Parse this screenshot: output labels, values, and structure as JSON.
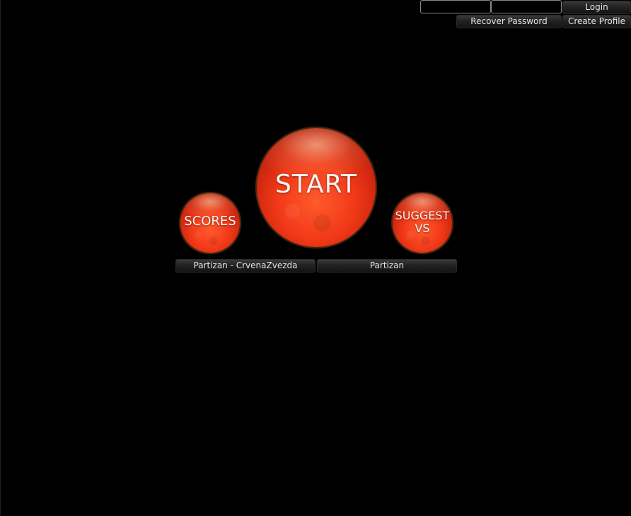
{
  "auth": {
    "username_value": "",
    "password_value": "",
    "login_label": "Login",
    "recover_label": "Recover Password",
    "create_label": "Create Profile"
  },
  "menu": {
    "start_label": "START",
    "scores_label": "SCORES",
    "suggest_label": "SUGGEST\nVS"
  },
  "selection": {
    "match_label": "Partizan - CrvenaZvezda",
    "team_label": "Partizan"
  },
  "colors": {
    "background": "#000000",
    "orb_red": "#f23a18",
    "button_dark": "#222222"
  }
}
